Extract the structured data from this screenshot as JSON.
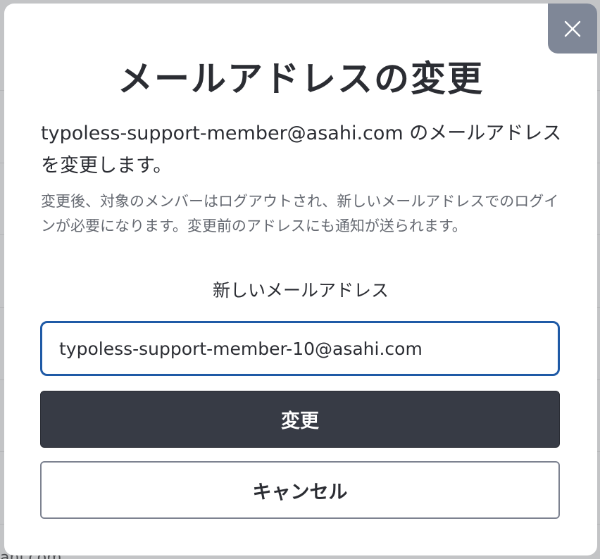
{
  "background": {
    "footer_fragment": "ahi.com"
  },
  "dialog": {
    "title": "メールアドレスの変更",
    "intro": "typoless-support-member@asahi.com のメールアドレスを変更します。",
    "note": "変更後、対象のメンバーはログアウトされ、新しいメールアドレスでのログインが必要になります。変更前のアドレスにも通知が送られます。",
    "field_label": "新しいメールアドレス",
    "email_value": "typoless-support-member-10@asahi.com",
    "submit_label": "変更",
    "cancel_label": "キャンセル",
    "close_icon": "close-icon"
  },
  "colors": {
    "overlay": "#c3c4c6",
    "close_button_bg": "#7f8797",
    "primary_button_bg": "#373b45",
    "input_border_focus": "#1f5aa6",
    "text_primary": "#2b2d33",
    "text_secondary": "#666a72"
  }
}
